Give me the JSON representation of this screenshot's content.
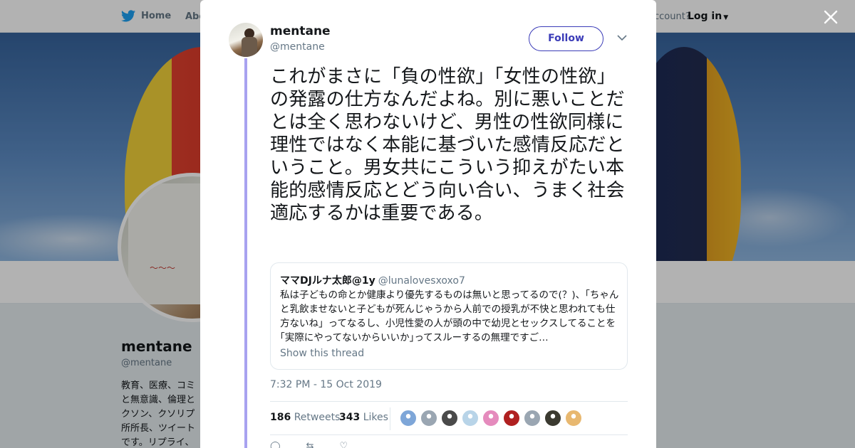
{
  "topnav": {
    "home_label": "Home",
    "about_label": "Abo",
    "account_prompt": "ccount?",
    "login_label": "Log in"
  },
  "profile": {
    "name": "mentane",
    "handle": "@mentane",
    "bio_lines": [
      "教育、医療、コミ",
      "と無意識、倫理と",
      "クソン、クソリプ",
      "所所長、ツイート",
      "です。リプライ、"
    ]
  },
  "tweet": {
    "author_name": "mentane",
    "author_handle": "@mentane",
    "follow_label": "Follow",
    "text": "これがまさに「負の性欲」「女性の性欲」の発露の仕方なんだよね。別に悪いことだとは全く思わないけど、男性の性欲同様に理性ではなく本能に基づいた感情反応だということ。男女共にこういう抑えがたい本能的感情反応とどう向い合い、うまく社会適応するかは重要である。",
    "quote": {
      "name": "ママDJルナ太郎@1y",
      "handle": "@lunalovesxoxo7",
      "text": "私は子どもの命とか健康より優先するものは無いと思ってるので(？)、「ちゃんと乳飲ませないと子どもが死んじゃうから人前での授乳が不快と思われても仕方ないね」ってなるし、小児性愛の人が頭の中で幼児とセックスしてることを｢実際にやってないからいいか｣ってスルーするの無理ですご…",
      "show_thread_label": "Show this thread"
    },
    "timestamp": "7:32 PM - 15 Oct 2019",
    "stats": {
      "retweets_count": "186",
      "retweets_label": "Retweets",
      "likes_count": "343",
      "likes_label": "Likes"
    },
    "likers": [
      {
        "icon": "bird-avatar",
        "color": "#7ea6d8"
      },
      {
        "icon": "default-avatar",
        "color": "#9aa6b2"
      },
      {
        "icon": "sketch-avatar",
        "color": "#4a4a4a"
      },
      {
        "icon": "cartoon-avatar",
        "color": "#b8d4e8"
      },
      {
        "icon": "bunny-avatar",
        "color": "#e58bbd"
      },
      {
        "icon": "red-mask-avatar",
        "color": "#b02020"
      },
      {
        "icon": "default-avatar",
        "color": "#9aa6b2"
      },
      {
        "icon": "seal-avatar",
        "color": "#3b3a30"
      },
      {
        "icon": "anime-avatar",
        "color": "#e8b870"
      }
    ]
  }
}
